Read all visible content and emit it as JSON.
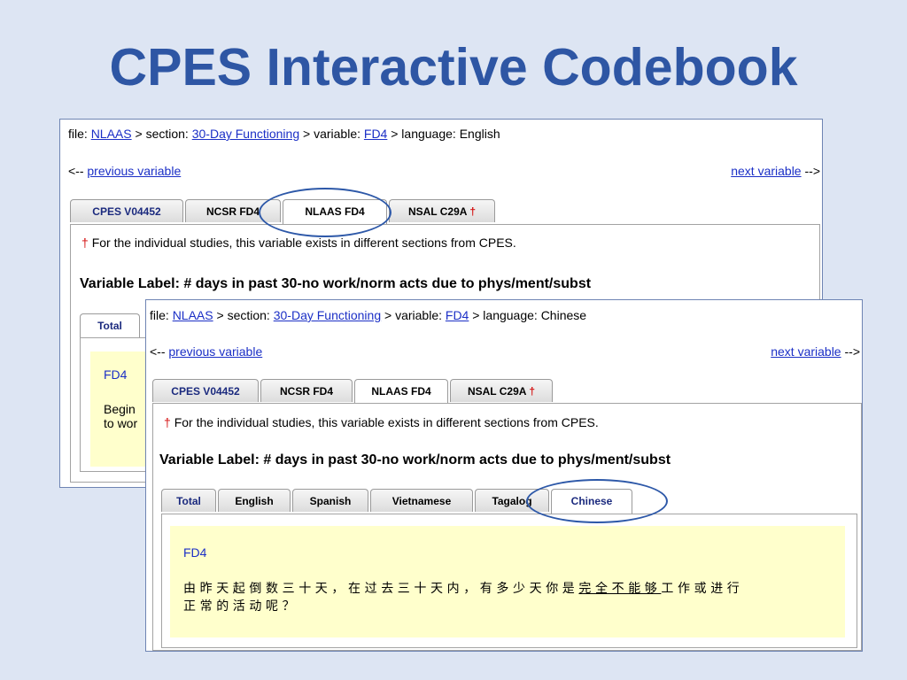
{
  "slide_title": "CPES Interactive Codebook",
  "colors": {
    "title": "#2e56a4",
    "link": "#1b2fc6",
    "highlight_box": "#ffffcc",
    "dagger": "#d41010",
    "circle": "#2d58a8"
  },
  "panel1": {
    "crumb": {
      "file_prefix": "file:",
      "file": "NLAAS",
      "section_prefix": "> section:",
      "section": "30-Day Functioning",
      "variable_prefix": "> variable:",
      "variable": "FD4",
      "language_text": "> language: English"
    },
    "prev_arrow": "<--",
    "prev_label": "previous variable",
    "next_label": "next variable",
    "next_arrow": "-->",
    "study_tabs": [
      "CPES V04452",
      "NCSR FD4",
      "NLAAS FD4",
      "NSAL C29A"
    ],
    "dagger": "†",
    "note": "For the individual studies, this variable exists in different sections from CPES.",
    "var_label": "Variable Label: # days in past 30-no work/norm acts due to phys/ment/subst",
    "lang_tab_total": "Total",
    "code": "FD4",
    "question_line1_partial": "Begin",
    "question_line2_partial": "to wor"
  },
  "panel2": {
    "crumb": {
      "file_prefix": "file:",
      "file": "NLAAS",
      "section_prefix": "> section:",
      "section": "30-Day Functioning",
      "variable_prefix": "> variable:",
      "variable": "FD4",
      "language_text": "> language: Chinese"
    },
    "prev_arrow": "<--",
    "prev_label": "previous variable",
    "next_label": "next variable",
    "next_arrow": "-->",
    "study_tabs": [
      "CPES V04452",
      "NCSR FD4",
      "NLAAS FD4",
      "NSAL C29A"
    ],
    "dagger": "†",
    "note": "For the individual studies, this variable exists in different sections from CPES.",
    "var_label": "Variable Label: # days in past 30-no work/norm acts due to phys/ment/subst",
    "lang_tabs": [
      "Total",
      "English",
      "Spanish",
      "Vietnamese",
      "Tagalog",
      "Chinese"
    ],
    "code": "FD4",
    "question_part1": "由昨天起倒数三十天，在过去三十天内，有多少天你是",
    "question_underlined": "完全不能够",
    "question_part2": "工作或进行",
    "question_line2": "正常的活动呢？"
  }
}
